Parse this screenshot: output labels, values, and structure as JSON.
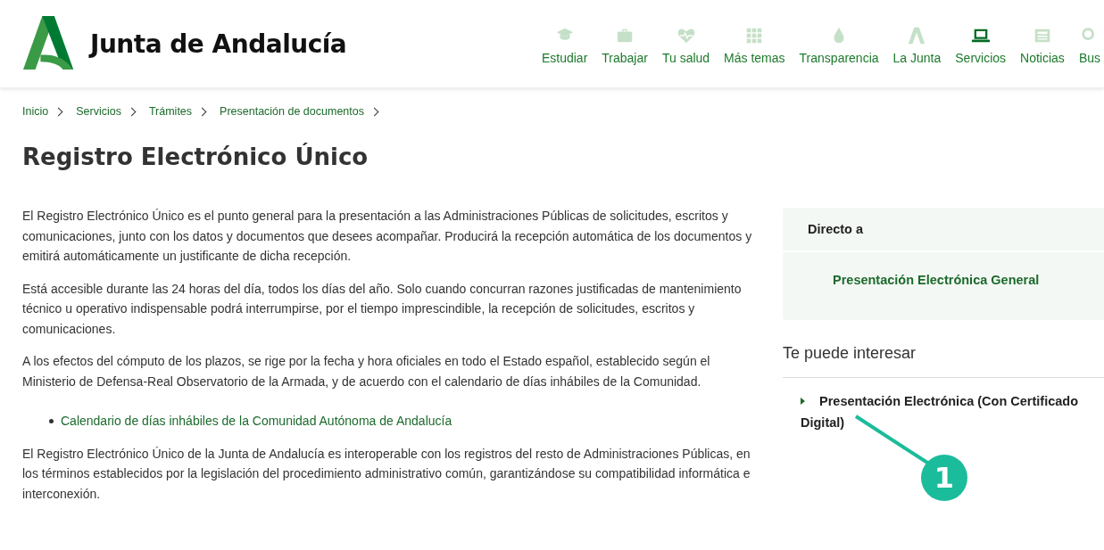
{
  "header": {
    "brand": "Junta de Andalucía",
    "nav": [
      {
        "label": "Estudiar",
        "kind": "cap",
        "selected": false
      },
      {
        "label": "Trabajar",
        "kind": "briefcase",
        "selected": false
      },
      {
        "label": "Tu salud",
        "kind": "heart",
        "selected": false
      },
      {
        "label": "Más temas",
        "kind": "grid",
        "selected": false
      },
      {
        "label": "Transparencia",
        "kind": "drop",
        "selected": false
      },
      {
        "label": "La Junta",
        "kind": "letter",
        "selected": false
      },
      {
        "label": "Servicios",
        "kind": "laptop",
        "selected": true
      },
      {
        "label": "Noticias",
        "kind": "news",
        "selected": false
      },
      {
        "label": "Bus",
        "kind": "search",
        "selected": false
      }
    ]
  },
  "breadcrumb": [
    "Inicio",
    "Servicios",
    "Trámites",
    "Presentación de documentos"
  ],
  "title": "Registro Electrónico Único",
  "content": [
    {
      "kind": "p",
      "text": "El Registro Electrónico Único es el punto general para la presentación a las Administraciones Públicas de solicitudes, escritos y comunicaciones, junto con los datos y documentos que desees acompañar. Producirá la recepción automática de los documentos y emitirá automáticamente un justificante de dicha recepción."
    },
    {
      "kind": "p",
      "text": "Está accesible durante las 24 horas del día, todos los días del año. Solo cuando concurran razones justificadas de mantenimiento técnico u operativo indispensable podrá interrumpirse, por el tiempo imprescindible, la recepción de solicitudes, escritos y comunicaciones."
    },
    {
      "kind": "p",
      "text": "A los efectos del cómputo de los plazos, se rige por la fecha y hora oficiales en todo el Estado español, establecido según el Ministerio de Defensa-Real Observatorio de la Armada, y de acuerdo con el calendario de días inhábiles de la Comunidad."
    },
    {
      "kind": "link",
      "text": "Calendario de días inhábiles de la Comunidad Autónoma de Andalucía"
    },
    {
      "kind": "p",
      "text": "El Registro Electrónico Único de la Junta de Andalucía es interoperable con los registros del resto de Administraciones Públicas, en los términos establecidos por la legislación del procedimiento administrativo común, garantizándose su compatibilidad informática e interconexión."
    }
  ],
  "sidebar": {
    "direct_heading": "Directo a",
    "direct_links": [
      "Presentación Electrónica General"
    ],
    "interest_heading": "Te puede interesar",
    "interest_items": [
      "Presentación Electrónica (Con Certificado Digital)"
    ]
  },
  "annotation": {
    "label": "1"
  }
}
